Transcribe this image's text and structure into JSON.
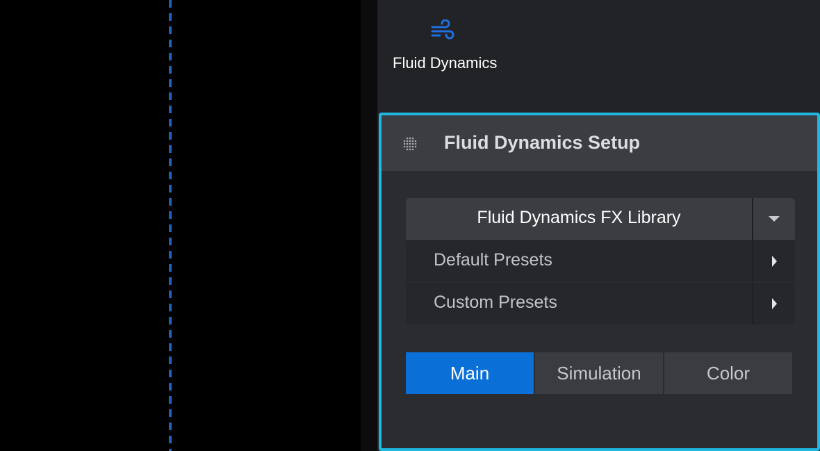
{
  "effect_tile": {
    "label": "Fluid Dynamics",
    "icon": "wind-icon"
  },
  "setup_panel": {
    "title": "Fluid Dynamics Setup",
    "handle_icon": "drag-handle-icon",
    "library": {
      "header_label": "Fluid Dynamics FX Library",
      "items": [
        {
          "label": "Default Presets"
        },
        {
          "label": "Custom Presets"
        }
      ]
    },
    "tabs": [
      {
        "label": "Main",
        "active": true
      },
      {
        "label": "Simulation",
        "active": false
      },
      {
        "label": "Color",
        "active": false
      }
    ]
  },
  "colors": {
    "accent_border": "#20b8e0",
    "active_tab": "#0a6fd6",
    "guide_line": "#1f5fc0",
    "icon_blue": "#1f6fe0"
  }
}
